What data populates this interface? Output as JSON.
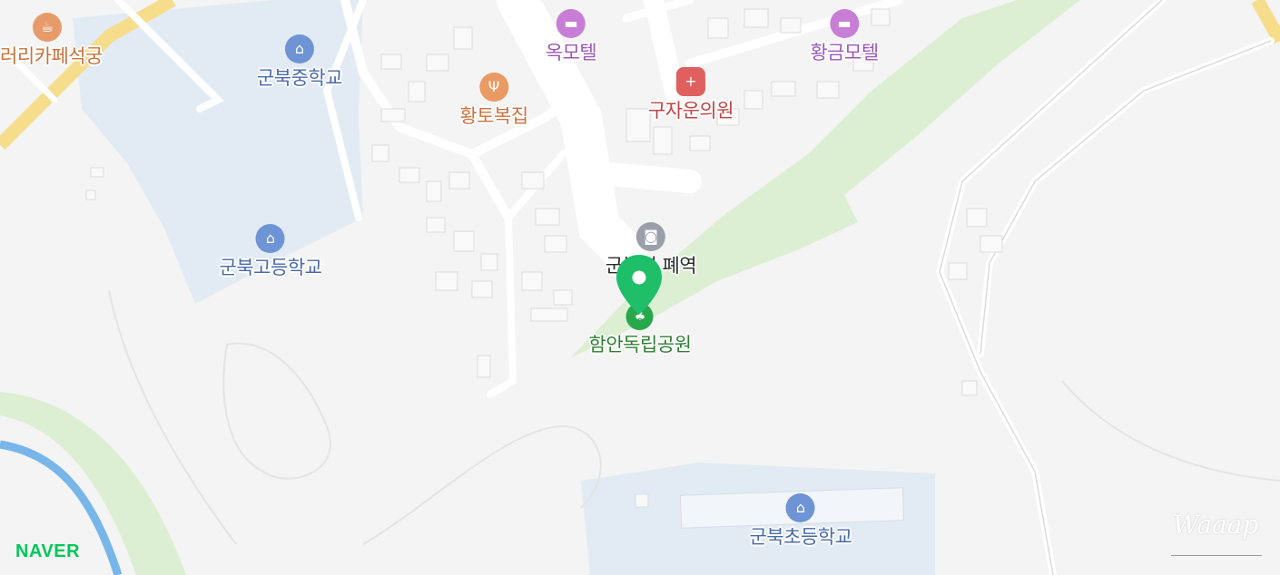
{
  "map": {
    "provider_logo": "NAVER",
    "provider_color": "#03c75a",
    "watermark": "Waaap"
  },
  "selected_place": {
    "name": "함안독립공원",
    "category_icon": "park-tree-icon",
    "color": "#27a84a"
  },
  "pois": [
    {
      "id": "cafe",
      "label": "러리카페석궁",
      "icon": "coffee-cup-icon",
      "color": "#e89b6a",
      "text_color": "#c8733d"
    },
    {
      "id": "motel-ok",
      "label": "옥모텔",
      "icon": "bed-icon",
      "color": "#c97ed6",
      "text_color": "#9b59b6"
    },
    {
      "id": "motel-hwanggeum",
      "label": "황금모텔",
      "icon": "bed-icon",
      "color": "#c97ed6",
      "text_color": "#9b59b6"
    },
    {
      "id": "middle-school",
      "label": "군북중학교",
      "icon": "school-icon",
      "color": "#6e94d6",
      "text_color": "#4a6aa8"
    },
    {
      "id": "restaurant",
      "label": "황토복집",
      "icon": "fork-knife-icon",
      "color": "#ea9a62",
      "text_color": "#c8733d"
    },
    {
      "id": "clinic",
      "label": "구자운의원",
      "icon": "medical-cross-icon",
      "color": "#e0605f",
      "text_color": "#c04444"
    },
    {
      "id": "high-school",
      "label": "군북고등학교",
      "icon": "school-icon",
      "color": "#6e94d6",
      "text_color": "#4a6aa8"
    },
    {
      "id": "station",
      "label": "군북역 폐역",
      "icon": "train-icon",
      "color": "#9aa0aa",
      "text_color": "#2b2b2b"
    },
    {
      "id": "elementary-school",
      "label": "군북초등학교",
      "icon": "school-icon",
      "color": "#6e94d6",
      "text_color": "#4a6aa8"
    }
  ]
}
